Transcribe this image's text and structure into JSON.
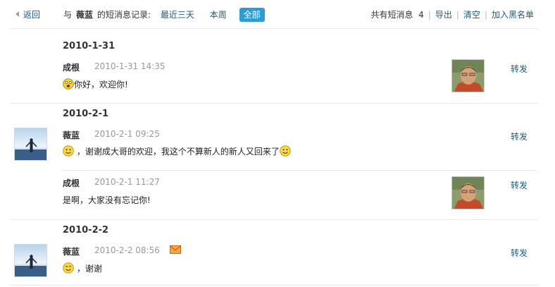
{
  "toolbar": {
    "back_label": "返回",
    "prefix": "与",
    "contact_name": "薇蓝",
    "suffix": "的短消息记录:",
    "filters": [
      "最近三天",
      "本周",
      "全部"
    ],
    "selected_filter": "全部",
    "count_label": "共有短消息",
    "count": "4",
    "export_label": "导出",
    "clear_label": "清空",
    "blacklist_label": "加入黑名单"
  },
  "groups": [
    {
      "date": "2010-1-31",
      "messages": [
        {
          "author": "成根",
          "time": "2010-1-31 14:35",
          "text": "你好，欢迎你!",
          "side": "right",
          "emoticon": "grin-emoticon",
          "forward": "转发"
        }
      ]
    },
    {
      "date": "2010-2-1",
      "messages": [
        {
          "author": "薇蓝",
          "time": "2010-2-1 09:25",
          "text": "，谢谢成大哥的欢迎，我这个不算新人的新人又回来了",
          "side": "left",
          "emoticon": "smile-emoticon",
          "forward": "转发"
        },
        {
          "author": "成根",
          "time": "2010-2-1 11:27",
          "text": "是啊，大家没有忘记你!",
          "side": "right",
          "emoticon": "",
          "forward": "转发"
        }
      ]
    },
    {
      "date": "2010-2-2",
      "messages": [
        {
          "author": "薇蓝",
          "time": "2010-2-2 08:56",
          "text": "，谢谢",
          "side": "left",
          "emoticon": "smile-emoticon",
          "forward": "转发",
          "status_icon": "unread-mail-icon"
        }
      ]
    }
  ],
  "colors": {
    "link": "#1f5b7a",
    "selected_filter_bg": "#2e9dd6",
    "time": "#999999",
    "mail_icon": "#e8821e"
  }
}
